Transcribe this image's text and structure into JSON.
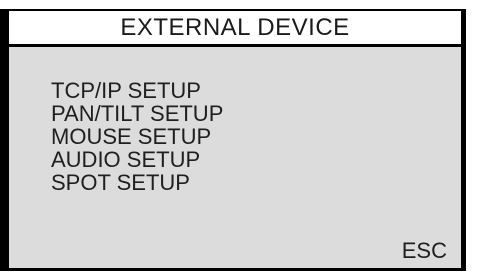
{
  "title": "EXTERNAL DEVICE",
  "menu": {
    "items": [
      {
        "label": "TCP/IP SETUP"
      },
      {
        "label": "PAN/TILT SETUP"
      },
      {
        "label": "MOUSE SETUP"
      },
      {
        "label": "AUDIO SETUP"
      },
      {
        "label": "SPOT SETUP"
      }
    ]
  },
  "esc_label": "ESC",
  "colors": {
    "panel_background": "#dcdcdc",
    "title_background": "#ffffff",
    "border": "#000000",
    "text": "#1f1f1f"
  }
}
